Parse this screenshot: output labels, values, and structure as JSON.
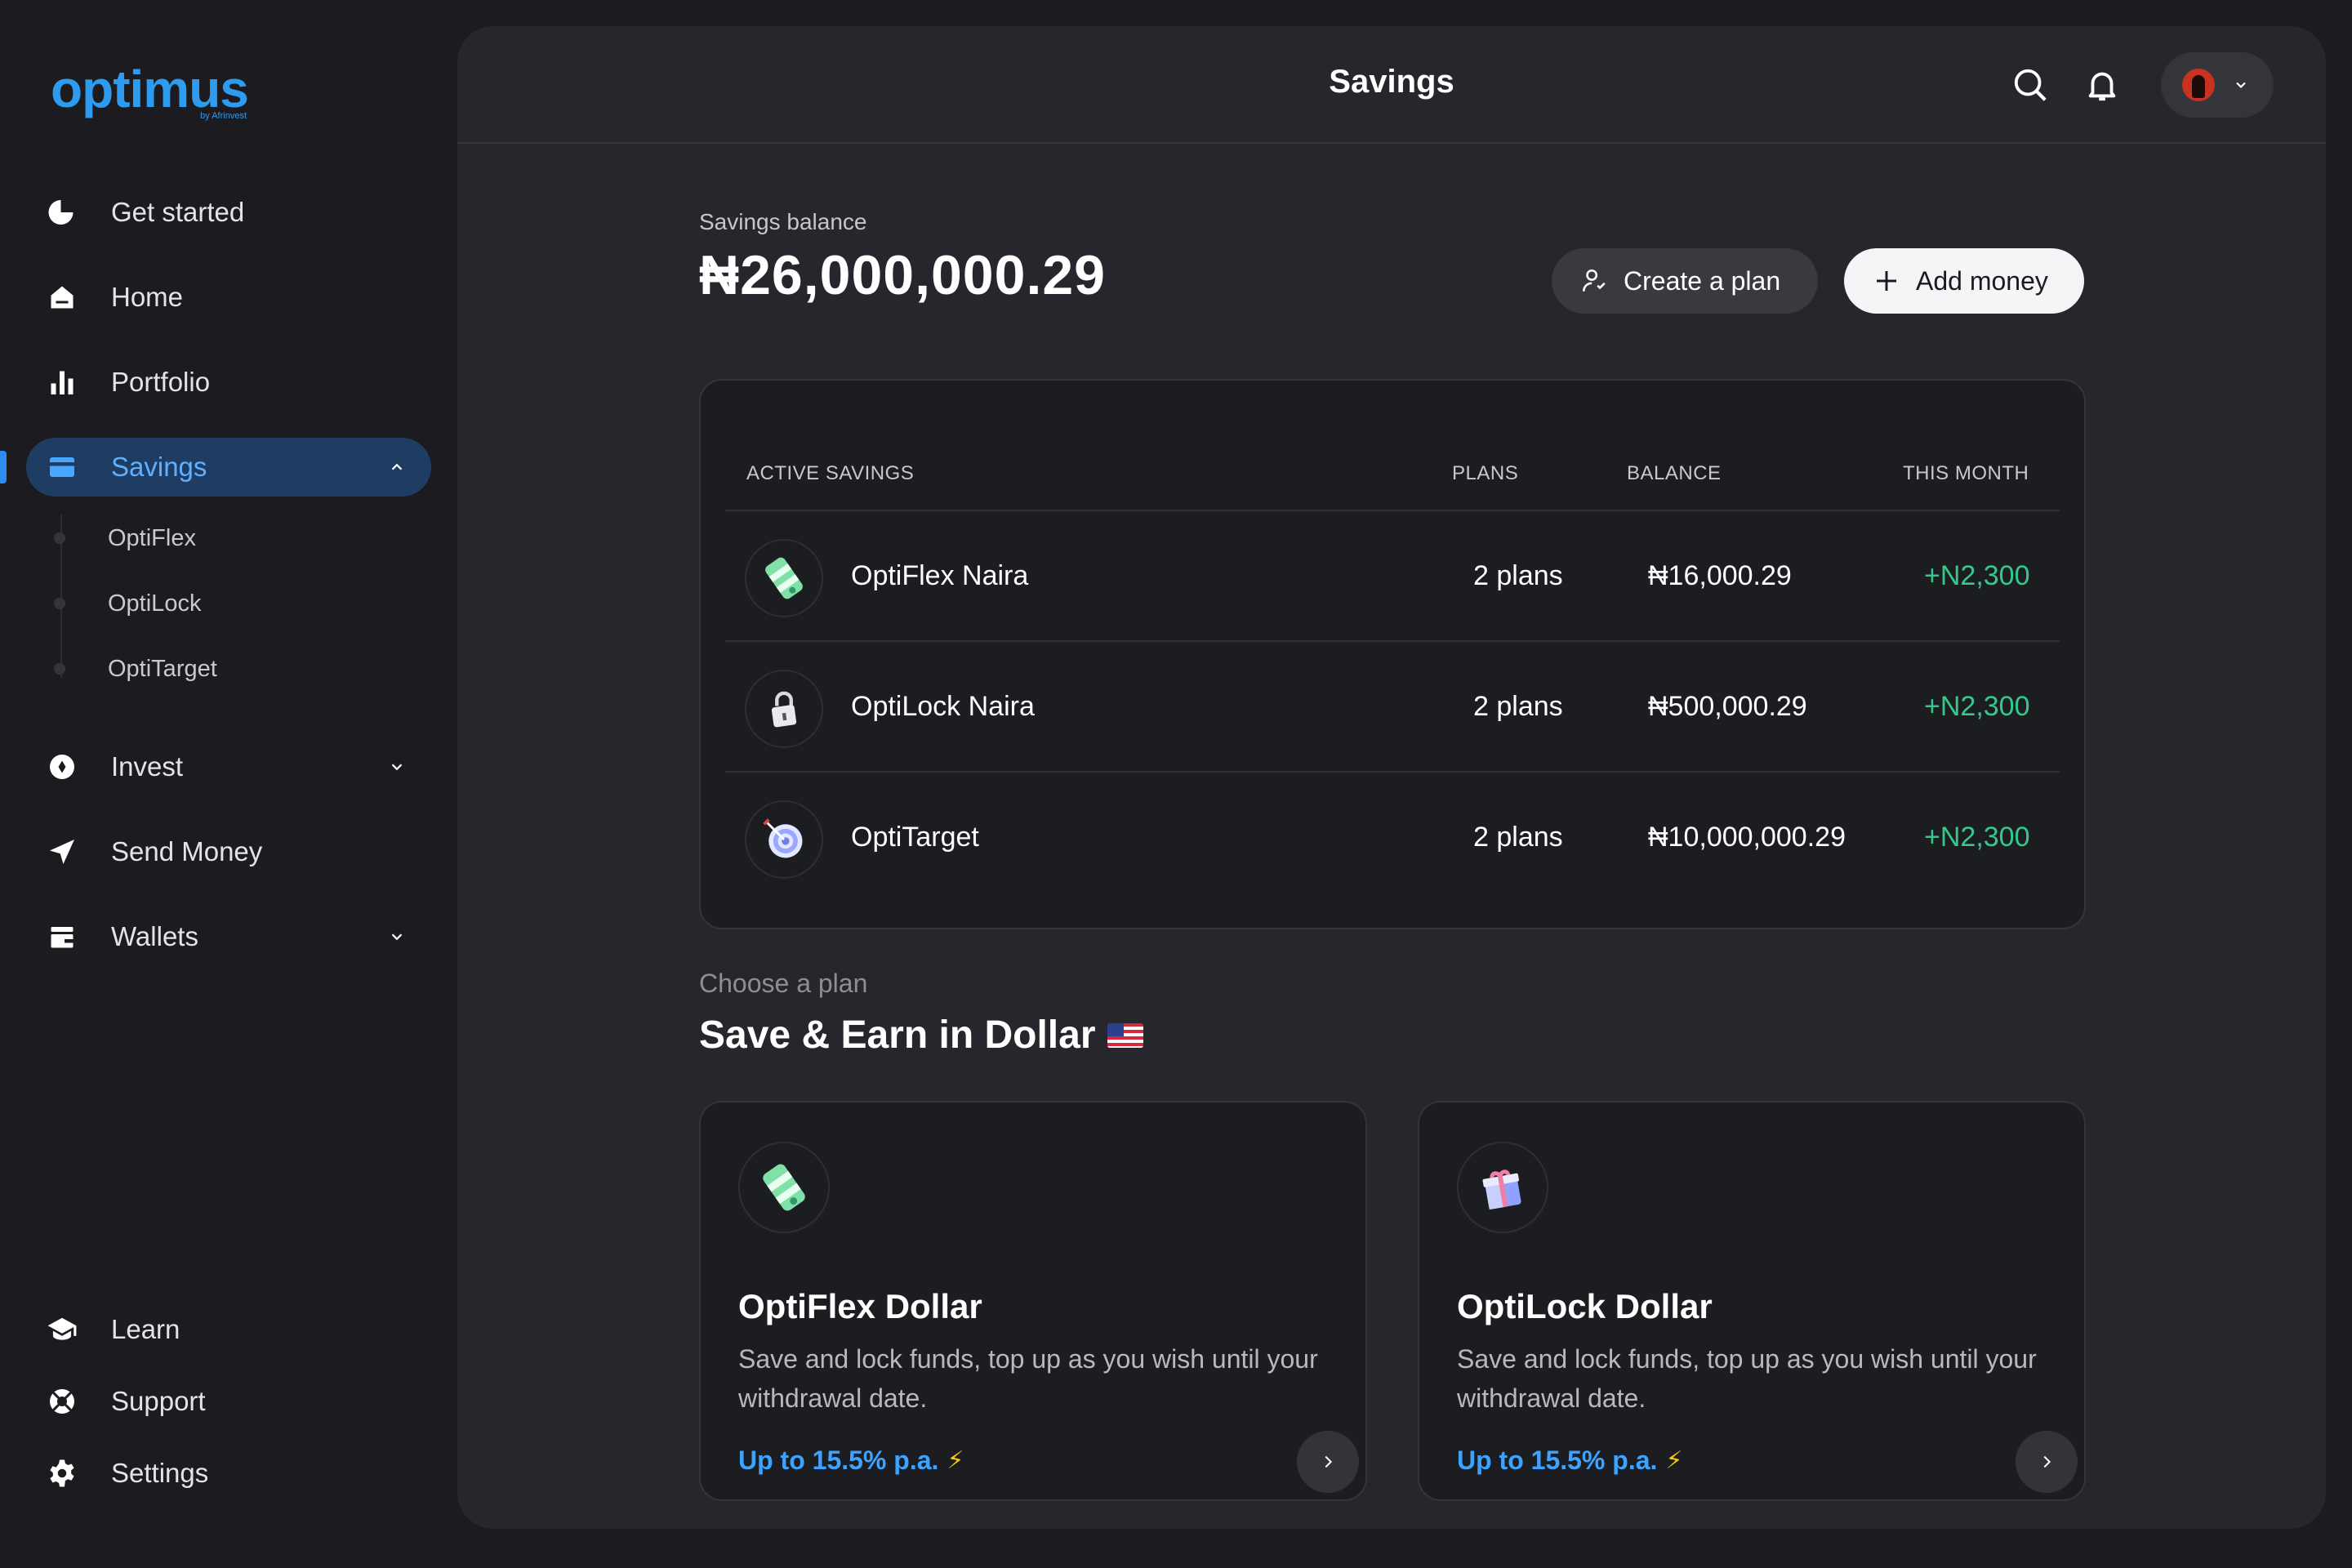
{
  "brand": {
    "name": "optimus",
    "tagline": "by Afrinvest",
    "accent": "#2c9bf0"
  },
  "sidebar": {
    "items": [
      {
        "label": "Get started",
        "icon": "pie-chart-icon"
      },
      {
        "label": "Home",
        "icon": "home-icon"
      },
      {
        "label": "Portfolio",
        "icon": "bar-chart-icon"
      },
      {
        "label": "Savings",
        "icon": "card-icon",
        "active": true,
        "expanded": true
      },
      {
        "label": "Invest",
        "icon": "compass-icon"
      },
      {
        "label": "Send Money",
        "icon": "send-icon"
      },
      {
        "label": "Wallets",
        "icon": "wallet-icon"
      }
    ],
    "savings_sub": [
      "OptiFlex",
      "OptiLock",
      "OptiTarget"
    ],
    "bottom": [
      {
        "label": "Learn",
        "icon": "graduation-cap-icon"
      },
      {
        "label": "Support",
        "icon": "lifebuoy-icon"
      },
      {
        "label": "Settings",
        "icon": "gear-icon"
      }
    ]
  },
  "header": {
    "title": "Savings"
  },
  "balance": {
    "label": "Savings balance",
    "value": "₦26,000,000.29",
    "create_label": "Create a plan",
    "add_label": "Add money"
  },
  "table": {
    "headers": {
      "name": "ACTIVE SAVINGS",
      "plans": "PLANS",
      "balance": "BALANCE",
      "month": "THIS MONTH"
    },
    "rows": [
      {
        "name": "OptiFlex Naira",
        "plans": "2 plans",
        "balance": "₦16,000.29",
        "month": "+N2,300",
        "icon": "money-roll-icon"
      },
      {
        "name": "OptiLock Naira",
        "plans": "2 plans",
        "balance": "₦500,000.29",
        "month": "+N2,300",
        "icon": "padlock-icon"
      },
      {
        "name": "OptiTarget",
        "plans": "2 plans",
        "balance": "₦10,000,000.29",
        "month": "+N2,300",
        "icon": "target-icon"
      }
    ],
    "positive_color": "#34c88a"
  },
  "plans": {
    "kicker": "Choose a plan",
    "title": "Save & Earn in Dollar",
    "cards": [
      {
        "title": "OptiFlex Dollar",
        "desc": "Save and lock funds, top up as you wish until your withdrawal date.",
        "rate": "Up to 15.5% p.a.",
        "icon": "money-roll-icon"
      },
      {
        "title": "OptiLock Dollar",
        "desc": "Save and lock funds, top up as you wish until your withdrawal date.",
        "rate": "Up to 15.5% p.a.",
        "icon": "gift-box-icon"
      }
    ]
  }
}
